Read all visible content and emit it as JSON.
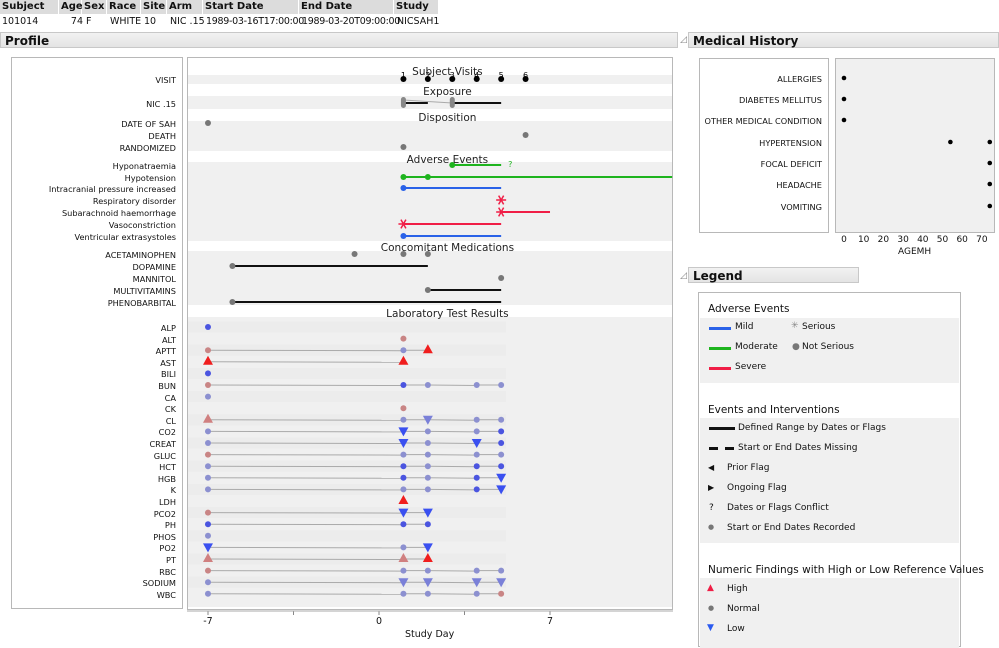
{
  "header": {
    "columns": [
      "Subject",
      "Age",
      "Sex",
      "Race",
      "Site",
      "Arm",
      "Start Date",
      "End Date",
      "Study"
    ],
    "values": [
      "101014",
      "74",
      "F",
      "WHITE",
      "10",
      "NIC .15",
      "1989-03-16T17:00:00",
      "1989-03-20T09:00:00",
      "NICSAH1"
    ]
  },
  "profile": {
    "title": "Profile",
    "xlabel": "Study Day",
    "xticks": [
      "-7",
      "0",
      "7"
    ],
    "sections": [
      {
        "title": "Subject Visits",
        "rows": [
          "VISIT"
        ]
      },
      {
        "title": "Exposure",
        "rows": [
          "NIC .15"
        ]
      },
      {
        "title": "Disposition",
        "rows": [
          "DATE OF SAH",
          "DEATH",
          "RANDOMIZED"
        ]
      },
      {
        "title": "Adverse Events",
        "rows": [
          "Hyponatraemia",
          "Hypotension",
          "Intracranial pressure increased",
          "Respiratory disorder",
          "Subarachnoid haemorrhage",
          "Vasoconstriction",
          "Ventricular extrasystoles"
        ]
      },
      {
        "title": "Concomitant Medications",
        "rows": [
          "ACETAMINOPHEN",
          "DOPAMINE",
          "MANNITOL",
          "MULTIVITAMINS",
          "PHENOBARBITAL"
        ]
      },
      {
        "title": "Laboratory Test Results",
        "rows": [
          "ALP",
          "ALT",
          "APTT",
          "AST",
          "BILI",
          "BUN",
          "CA",
          "CK",
          "CL",
          "CO2",
          "CREAT",
          "GLUC",
          "HCT",
          "HGB",
          "K",
          "LDH",
          "PCO2",
          "PH",
          "PHOS",
          "PO2",
          "PT",
          "RBC",
          "SODIUM",
          "WBC"
        ]
      }
    ]
  },
  "chart_data": {
    "type": "scatter",
    "xlabel": "Study Day",
    "xlim": [
      -7.9,
      12
    ],
    "visits": {
      "days": [
        1,
        2,
        3,
        4,
        5,
        6
      ],
      "labels": [
        "1",
        "2",
        "3",
        "4",
        "5",
        "6"
      ]
    },
    "exposure": {
      "segments": [
        [
          1,
          2
        ],
        [
          3,
          5
        ]
      ],
      "markers": [
        1,
        3
      ]
    },
    "disposition": [
      [
        -7
      ],
      [
        6
      ],
      [
        1
      ]
    ],
    "adverse_events": [
      {
        "start": 3,
        "end": 5,
        "severity": "Moderate",
        "serious": false,
        "conflict": true,
        "conflict_label": "?"
      },
      {
        "start": 1,
        "end": 12,
        "severity": "Moderate",
        "serious": false,
        "extra": [
          2
        ]
      },
      {
        "start": 1,
        "end": 5,
        "severity": "Mild",
        "serious": false
      },
      {
        "start": 5,
        "end": 5,
        "severity": "Severe",
        "serious": true
      },
      {
        "start": 5,
        "end": 7,
        "severity": "Severe",
        "serious": true
      },
      {
        "start": 1,
        "end": 5,
        "severity": "Severe",
        "serious": true
      },
      {
        "start": 1,
        "end": 5,
        "severity": "Mild",
        "serious": false
      }
    ],
    "conmeds": [
      {
        "points": [
          -1,
          1,
          2
        ]
      },
      {
        "start": -6,
        "end": 2
      },
      {
        "points": [
          5
        ]
      },
      {
        "start": 2,
        "end": 5
      },
      {
        "start": -6,
        "end": 5
      }
    ],
    "labs": [
      [
        [
          -7,
          "N",
          "s"
        ]
      ],
      [
        [
          1,
          "N",
          "p"
        ]
      ],
      [
        [
          -7,
          "N",
          "p"
        ],
        [
          1,
          "N",
          "f"
        ],
        [
          2,
          "H",
          "s"
        ]
      ],
      [
        [
          -7,
          "H",
          "s"
        ],
        [
          1,
          "H",
          "s"
        ]
      ],
      [
        [
          -7,
          "N",
          "s"
        ]
      ],
      [
        [
          -7,
          "N",
          "p"
        ],
        [
          1,
          "N",
          "s"
        ],
        [
          2,
          "N",
          "f"
        ],
        [
          4,
          "N",
          "f"
        ],
        [
          5,
          "N",
          "f"
        ]
      ],
      [
        [
          -7,
          "N",
          "f"
        ]
      ],
      [
        [
          1,
          "N",
          "p"
        ]
      ],
      [
        [
          -7,
          "H",
          "p"
        ],
        [
          1,
          "N",
          "f"
        ],
        [
          2,
          "L",
          "f"
        ],
        [
          4,
          "N",
          "f"
        ],
        [
          5,
          "N",
          "f"
        ]
      ],
      [
        [
          -7,
          "N",
          "f"
        ],
        [
          1,
          "L",
          "s"
        ],
        [
          2,
          "N",
          "f"
        ],
        [
          4,
          "N",
          "f"
        ],
        [
          5,
          "N",
          "s"
        ]
      ],
      [
        [
          -7,
          "N",
          "f"
        ],
        [
          1,
          "L",
          "s"
        ],
        [
          2,
          "N",
          "f"
        ],
        [
          4,
          "L",
          "s"
        ],
        [
          5,
          "N",
          "s"
        ]
      ],
      [
        [
          -7,
          "N",
          "p"
        ],
        [
          1,
          "N",
          "f"
        ],
        [
          2,
          "N",
          "f"
        ],
        [
          4,
          "N",
          "f"
        ],
        [
          5,
          "N",
          "f"
        ]
      ],
      [
        [
          -7,
          "N",
          "f"
        ],
        [
          1,
          "N",
          "s"
        ],
        [
          2,
          "N",
          "f"
        ],
        [
          4,
          "N",
          "s"
        ],
        [
          5,
          "N",
          "s"
        ]
      ],
      [
        [
          -7,
          "N",
          "f"
        ],
        [
          1,
          "N",
          "s"
        ],
        [
          2,
          "N",
          "f"
        ],
        [
          4,
          "N",
          "s"
        ],
        [
          5,
          "L",
          "s"
        ]
      ],
      [
        [
          -7,
          "N",
          "f"
        ],
        [
          1,
          "N",
          "f"
        ],
        [
          2,
          "N",
          "f"
        ],
        [
          4,
          "N",
          "s"
        ],
        [
          5,
          "L",
          "s"
        ]
      ],
      [
        [
          1,
          "H",
          "s"
        ]
      ],
      [
        [
          -7,
          "N",
          "p"
        ],
        [
          1,
          "L",
          "s"
        ],
        [
          2,
          "L",
          "s"
        ]
      ],
      [
        [
          -7,
          "N",
          "s"
        ],
        [
          1,
          "N",
          "s"
        ],
        [
          2,
          "N",
          "s"
        ]
      ],
      [
        [
          -7,
          "N",
          "f"
        ]
      ],
      [
        [
          -7,
          "L",
          "s"
        ],
        [
          1,
          "N",
          "f"
        ],
        [
          2,
          "L",
          "s"
        ]
      ],
      [
        [
          -7,
          "H",
          "p"
        ],
        [
          1,
          "H",
          "p"
        ],
        [
          2,
          "H",
          "s"
        ]
      ],
      [
        [
          -7,
          "N",
          "p"
        ],
        [
          1,
          "N",
          "f"
        ],
        [
          2,
          "N",
          "f"
        ],
        [
          4,
          "N",
          "f"
        ],
        [
          5,
          "N",
          "f"
        ]
      ],
      [
        [
          -7,
          "N",
          "f"
        ],
        [
          1,
          "L",
          "f"
        ],
        [
          2,
          "L",
          "f"
        ],
        [
          4,
          "L",
          "f"
        ],
        [
          5,
          "L",
          "f"
        ]
      ],
      [
        [
          -7,
          "N",
          "f"
        ],
        [
          1,
          "N",
          "f"
        ],
        [
          2,
          "N",
          "f"
        ],
        [
          4,
          "N",
          "f"
        ],
        [
          5,
          "N",
          "p"
        ]
      ]
    ],
    "medical_history": {
      "xlabel": "AGEMH",
      "xticks": [
        "0",
        "10",
        "20",
        "30",
        "40",
        "50",
        "60",
        "70"
      ],
      "rows": [
        "ALLERGIES",
        "DIABETES MELLITUS",
        "OTHER MEDICAL CONDITION",
        "HYPERTENSION",
        "FOCAL DEFICIT",
        "HEADACHE",
        "VOMITING"
      ],
      "values": [
        [
          0
        ],
        [
          0
        ],
        [
          0
        ],
        [
          54,
          74
        ],
        [
          74
        ],
        [
          74
        ],
        [
          74
        ]
      ]
    }
  },
  "colors": {
    "mild": "#2a62e8",
    "moderate": "#1eb41e",
    "severe": "#f01e46",
    "high": "#f01e1e",
    "low": "#3a50f0"
  },
  "medical_history": {
    "title": "Medical History"
  },
  "legend": {
    "title": "Legend",
    "ae_title": "Adverse Events",
    "mild": "Mild",
    "moderate": "Moderate",
    "severe": "Severe",
    "serious": "Serious",
    "not_serious": "Not Serious",
    "ei_title": "Events and Interventions",
    "defined": "Defined Range by Dates or Flags",
    "missing": "Start or End Dates Missing",
    "prior": "Prior Flag",
    "ongoing": "Ongoing Flag",
    "conflict_sym": "?",
    "conflict": "Dates or Flags Conflict",
    "recorded": "Start or End Dates Recorded",
    "nf_title": "Numeric Findings with High or Low Reference Values",
    "high": "High",
    "normal": "Normal",
    "low": "Low"
  }
}
